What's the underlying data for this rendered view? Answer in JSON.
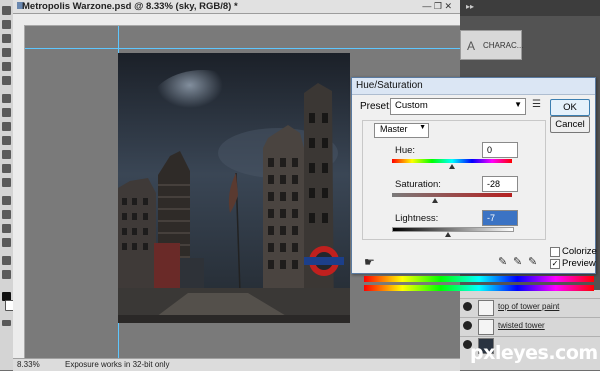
{
  "document": {
    "title": "Metropolis Warzone.psd @ 8.33% (sky, RGB/8) *",
    "window_controls": "—  ❐  ✕"
  },
  "status_bar": {
    "zoom": "8.33%",
    "message": "Exposure works in 32-bit only"
  },
  "character_panel": {
    "label": "CHARAC..."
  },
  "layers": [
    {
      "name": "top of tower paint"
    },
    {
      "name": "twisted tower"
    },
    {
      "name": ""
    }
  ],
  "dialog": {
    "title": "Hue/Saturation",
    "preset_label": "Preset:",
    "preset_value": "Custom",
    "ok_label": "OK",
    "cancel_label": "Cancel",
    "channel_value": "Master",
    "hue_label": "Hue:",
    "hue_value": "0",
    "saturation_label": "Saturation:",
    "saturation_value": "-28",
    "lightness_label": "Lightness:",
    "lightness_value": "-7",
    "colorize_label": "Colorize",
    "preview_label": "Preview",
    "preview_checked": true,
    "colorize_checked": false,
    "hue_level": 0.5,
    "saturation_level": 0.36,
    "lightness_level": 0.47
  },
  "watermark": {
    "text": "pxleyes.com"
  },
  "colors": {
    "guide": "#5ec7ff",
    "dialog_border": "#5a7aa0",
    "sky": "#2a3340"
  }
}
